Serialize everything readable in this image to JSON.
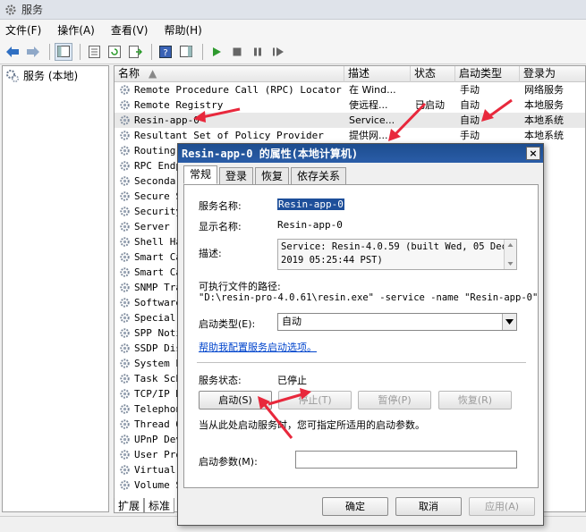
{
  "window": {
    "title": "服务"
  },
  "menu": [
    "文件(F)",
    "操作(A)",
    "查看(V)",
    "帮助(H)"
  ],
  "tree": {
    "root": "服务 (本地)"
  },
  "columns": [
    "名称",
    "描述",
    "状态",
    "启动类型",
    "登录为"
  ],
  "services": [
    {
      "name": "Remote Procedure Call (RPC) Locator",
      "desc": "在 Wind...",
      "status": "",
      "startup": "手动",
      "logon": "网络服务"
    },
    {
      "name": "Remote Registry",
      "desc": "使远程...",
      "status": "已启动",
      "startup": "自动",
      "logon": "本地服务"
    },
    {
      "name": "Resin-app-0",
      "desc": "Service...",
      "status": "",
      "startup": "自动",
      "logon": "本地系统"
    },
    {
      "name": "Resultant Set of Policy Provider",
      "desc": "提供网...",
      "status": "",
      "startup": "手动",
      "logon": "本地系统"
    },
    {
      "name": "Routing",
      "desc": "",
      "status": "",
      "startup": "",
      "logon": "系统"
    },
    {
      "name": "RPC Endp",
      "desc": "",
      "status": "",
      "startup": "",
      "logon": "系统"
    },
    {
      "name": "Secondar",
      "desc": "",
      "status": "",
      "startup": "",
      "logon": "系统"
    },
    {
      "name": "Secure S",
      "desc": "",
      "status": "",
      "startup": "",
      "logon": "系统"
    },
    {
      "name": "Security",
      "desc": "",
      "status": "",
      "startup": "",
      "logon": "系统"
    },
    {
      "name": "Server",
      "desc": "",
      "status": "",
      "startup": "",
      "logon": "系统"
    },
    {
      "name": "Shell Ha",
      "desc": "",
      "status": "",
      "startup": "",
      "logon": "系统"
    },
    {
      "name": "Smart Ca",
      "desc": "",
      "status": "",
      "startup": "",
      "logon": "服务"
    },
    {
      "name": "Smart Ca",
      "desc": "",
      "status": "",
      "startup": "",
      "logon": "系统"
    },
    {
      "name": "SNMP Tra",
      "desc": "",
      "status": "",
      "startup": "",
      "logon": "服务"
    },
    {
      "name": "Software",
      "desc": "",
      "status": "",
      "startup": "",
      "logon": "系统"
    },
    {
      "name": "Special",
      "desc": "",
      "status": "",
      "startup": "",
      "logon": "系统"
    },
    {
      "name": "SPP Noti",
      "desc": "",
      "status": "",
      "startup": "",
      "logon": "服务"
    },
    {
      "name": "SSDP Dis",
      "desc": "",
      "status": "",
      "startup": "",
      "logon": "服务"
    },
    {
      "name": "System E",
      "desc": "",
      "status": "",
      "startup": "",
      "logon": "系统"
    },
    {
      "name": "Task Sch",
      "desc": "",
      "status": "",
      "startup": "",
      "logon": "系统"
    },
    {
      "name": "TCP/IP N",
      "desc": "",
      "status": "",
      "startup": "",
      "logon": "服务"
    },
    {
      "name": "Telephon",
      "desc": "",
      "status": "",
      "startup": "",
      "logon": "服务"
    },
    {
      "name": "Thread O",
      "desc": "",
      "status": "",
      "startup": "",
      "logon": "服务"
    },
    {
      "name": "UPnP Dev",
      "desc": "",
      "status": "",
      "startup": "",
      "logon": "服务"
    },
    {
      "name": "User Pro",
      "desc": "",
      "status": "",
      "startup": "",
      "logon": "系统"
    },
    {
      "name": "Virtual",
      "desc": "",
      "status": "",
      "startup": "",
      "logon": "系统"
    },
    {
      "name": "Volume S",
      "desc": "",
      "status": "",
      "startup": "",
      "logon": "系统"
    }
  ],
  "bottom_tabs": [
    "扩展",
    "标准"
  ],
  "dialog": {
    "title": "Resin-app-0 的属性(本地计算机)",
    "close": "×",
    "tabs": [
      "常规",
      "登录",
      "恢复",
      "依存关系"
    ],
    "service_name_label": "服务名称:",
    "service_name": "Resin-app-0",
    "display_name_label": "显示名称:",
    "display_name": "Resin-app-0",
    "desc_label": "描述:",
    "desc_line1": "Service: Resin-4.0.59 (built Wed, 05 Dec",
    "desc_line2": "2019 05:25:44 PST)",
    "exe_label": "可执行文件的路径:",
    "exe_path": "\"D:\\resin-pro-4.0.61\\resin.exe\" -service -name \"Resin-app-0\"",
    "startup_label": "启动类型(E):",
    "startup_value": "自动",
    "help_link": "帮助我配置服务启动选项。",
    "status_label": "服务状态:",
    "status_value": "已停止",
    "btn_start": "启动(S)",
    "btn_stop": "停止(T)",
    "btn_pause": "暂停(P)",
    "btn_resume": "恢复(R)",
    "hint": "当从此处启动服务时，您可指定所适用的启动参数。",
    "param_label": "启动参数(M):",
    "param_value": "",
    "ok": "确定",
    "cancel": "取消",
    "apply": "应用(A)"
  },
  "colors": {
    "selection": "#1e4f9a",
    "title_bar": "#1d4d8f",
    "arrow": "#e8283c",
    "play": "#2e9a2e"
  }
}
